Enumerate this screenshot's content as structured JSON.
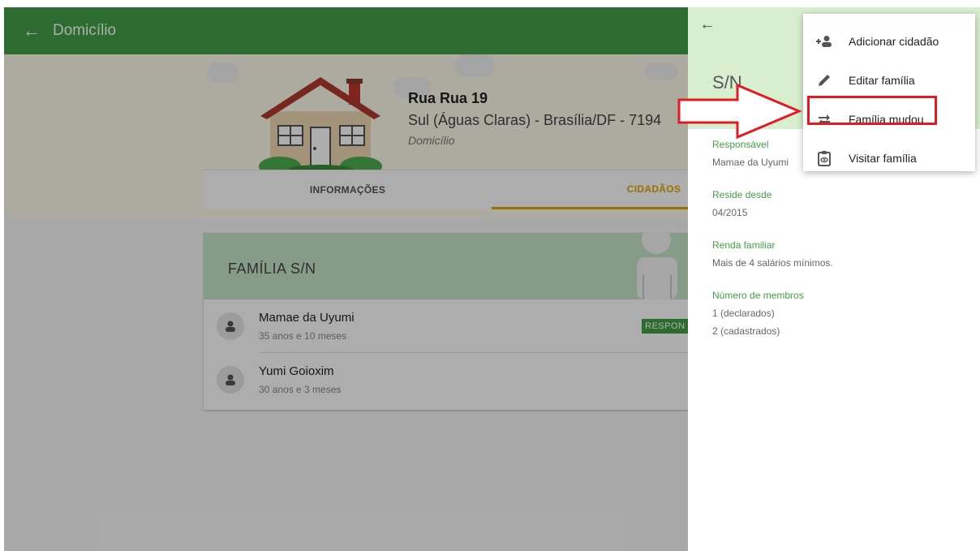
{
  "appbar": {
    "title": "Domicílio",
    "back_icon": "arrow-left-icon"
  },
  "address": {
    "street": "Rua Rua 19",
    "line2": "Sul (Águas Claras) - Brasília/DF - 7194",
    "type": "Domicílio"
  },
  "tabs": [
    {
      "label": "INFORMAÇÕES"
    },
    {
      "label": "CIDADÃOS"
    }
  ],
  "family": {
    "title": "FAMÍLIA S/N",
    "members": [
      {
        "name": "Mamae da Uyumi",
        "age": "35 anos e 10 meses",
        "badge": "RESPON"
      },
      {
        "name": "Yumi Goioxim",
        "age": "30 anos e 3 meses"
      }
    ]
  },
  "panel": {
    "title": "S/N",
    "fields": [
      {
        "label": "Responsável",
        "value": "Mamae da Uyumi"
      },
      {
        "label": "Reside desde",
        "value": "04/2015"
      },
      {
        "label": "Renda familiar",
        "value": "Mais de 4 salários mínimos."
      },
      {
        "label": "Número de membros",
        "value": "1 (declarados)",
        "value2": "2 (cadastrados)"
      }
    ]
  },
  "menu": {
    "items": [
      {
        "label": "Adicionar cidadão",
        "icon": "person-add-icon"
      },
      {
        "label": "Editar família",
        "icon": "pencil-icon"
      },
      {
        "label": "Família mudou",
        "icon": "swap-arrows-icon"
      },
      {
        "label": "Visitar família",
        "icon": "clipboard-eye-icon"
      }
    ]
  },
  "colors": {
    "primary_green": "#43a047",
    "accent_yellow": "#e0a800",
    "annotation_red": "#e21b23"
  }
}
